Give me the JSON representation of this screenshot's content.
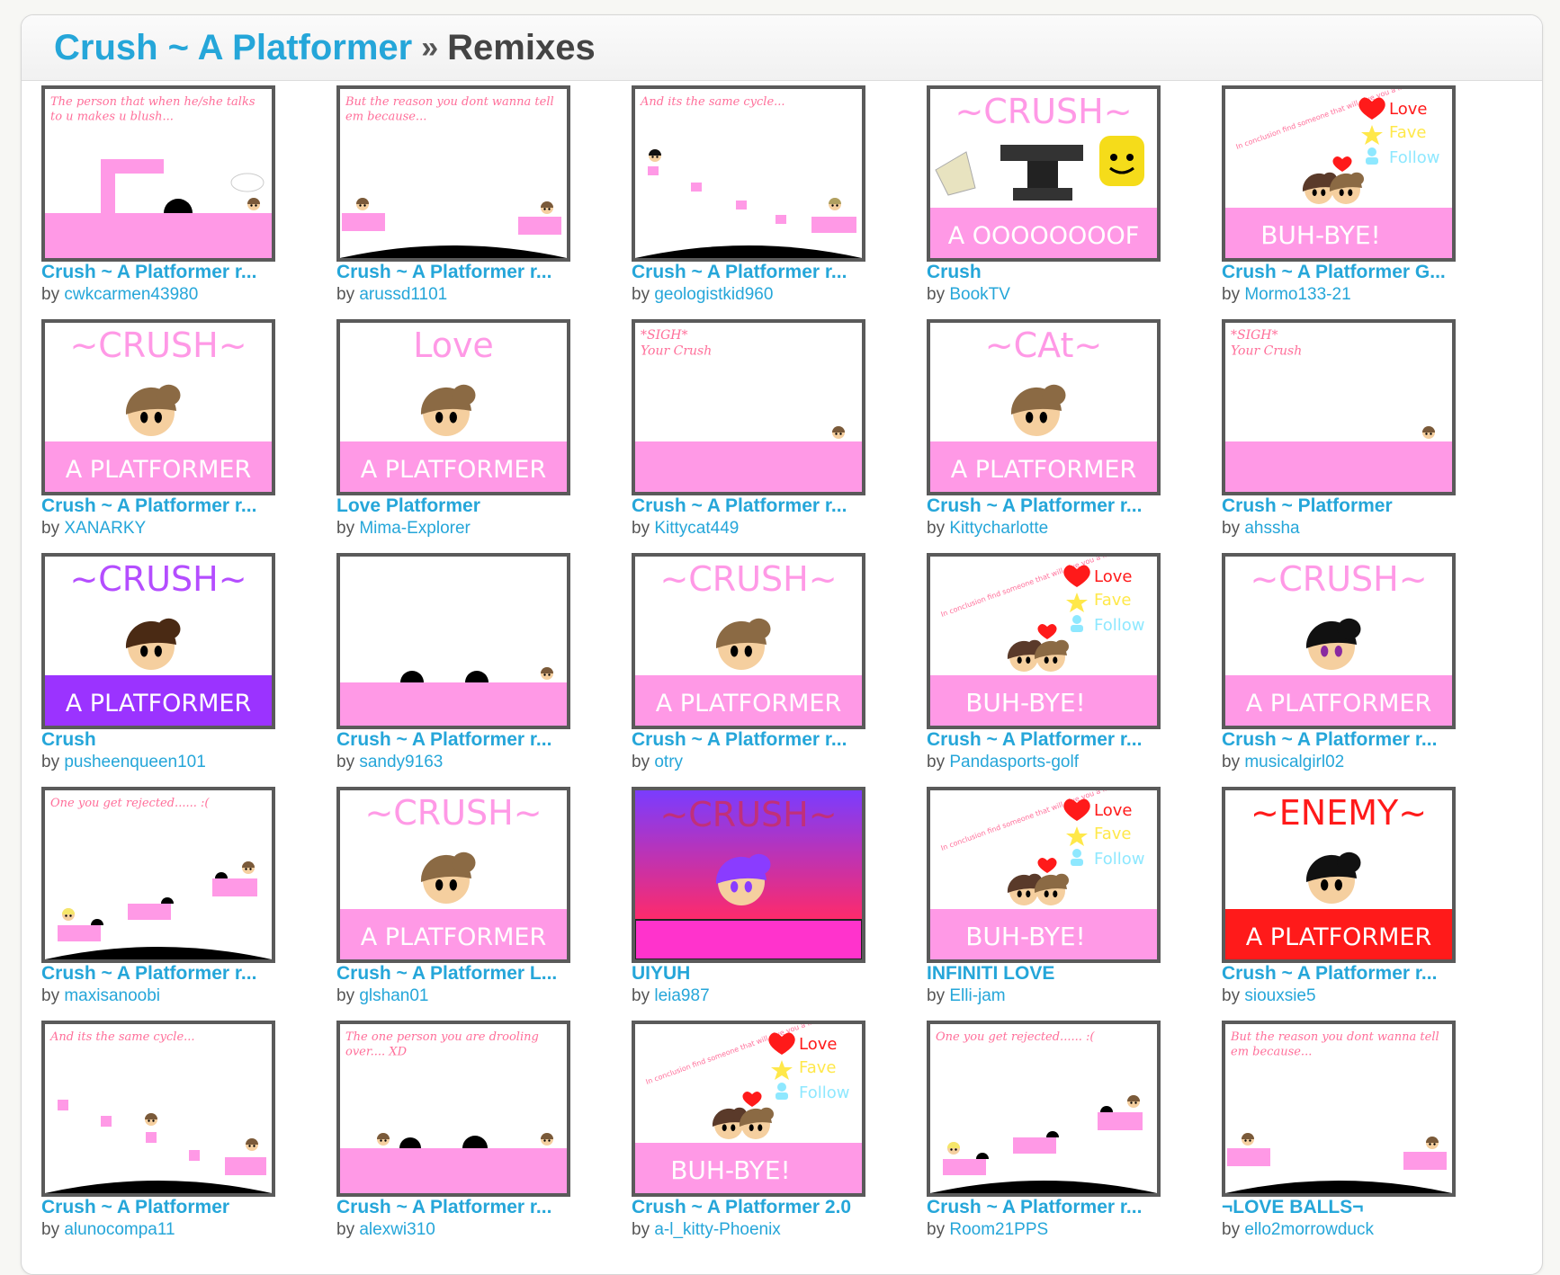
{
  "header": {
    "project_title": "Crush ~ A Platformer",
    "separator": "»",
    "page_title": "Remixes"
  },
  "by_label": "by",
  "colors": {
    "link": "#25a6d9",
    "pink": "#ff99e6",
    "frame": "#5a5a5a"
  },
  "projects": [
    {
      "title": "Crush ~ A Platformer r...",
      "author": "cwkcarmen43980",
      "thumb": {
        "kind": "level",
        "caption": "The person that when he/she talks to u makes u blush...",
        "variant": 1
      }
    },
    {
      "title": "Crush ~ A Platformer r...",
      "author": "arussd1101",
      "thumb": {
        "kind": "level",
        "caption": "But the reason you dont wanna tell em because...",
        "variant": 2
      }
    },
    {
      "title": "Crush ~ A Platformer r...",
      "author": "geologistkid960",
      "thumb": {
        "kind": "level",
        "caption": "And its the same cycle...",
        "variant": 3
      }
    },
    {
      "title": "Crush",
      "author": "BookTV",
      "thumb": {
        "kind": "banner",
        "heading": "~CRUSH~",
        "band": "A OOOOOOOOF",
        "band_color": "#ff99e6",
        "heading_color": "#ff99e6",
        "variant": "oof"
      }
    },
    {
      "title": "Crush ~ A Platformer G...",
      "author": "Mormo133-21",
      "thumb": {
        "kind": "bye",
        "band": "BUH-BYE!",
        "love": "Love",
        "fave": "Fave",
        "follow": "Follow",
        "note": "In conclusion find someone that will give you a lifetime of love!"
      }
    },
    {
      "title": "Crush ~ A Platformer r...",
      "author": "XANARKY",
      "thumb": {
        "kind": "banner",
        "heading": "~CRUSH~",
        "band": "A PLATFORMER",
        "band_color": "#ff99e6",
        "heading_color": "#ff99e6",
        "variant": "face"
      }
    },
    {
      "title": "Love Platformer",
      "author": "Mima-Explorer",
      "thumb": {
        "kind": "banner",
        "heading": "Love",
        "band": "A PLATFORMER",
        "band_color": "#ff99e6",
        "heading_color": "#ff99e6",
        "variant": "face"
      }
    },
    {
      "title": "Crush ~ A Platformer r...",
      "author": "Kittycat449",
      "thumb": {
        "kind": "sigh",
        "caption": "*SIGH* Your Crush"
      }
    },
    {
      "title": "Crush ~ A Platformer r...",
      "author": "Kittycharlotte",
      "thumb": {
        "kind": "banner",
        "heading": "~CAt~",
        "band": "A PLATFORMER",
        "band_color": "#ff99e6",
        "heading_color": "#ff99e6",
        "variant": "face"
      }
    },
    {
      "title": "Crush ~ Platformer",
      "author": "ahssha",
      "thumb": {
        "kind": "sigh",
        "caption": "*SIGH* Your Crush"
      }
    },
    {
      "title": "Crush",
      "author": "pusheenqueen101",
      "thumb": {
        "kind": "banner",
        "heading": "~CRUSH~",
        "band": "A PLATFORMER",
        "band_color": "#9b33ff",
        "heading_color": "#b44dff",
        "variant": "darkface"
      }
    },
    {
      "title": "Crush ~ A Platformer r...",
      "author": "sandy9163",
      "thumb": {
        "kind": "level",
        "caption": "",
        "variant": 4
      }
    },
    {
      "title": "Crush ~ A Platformer r...",
      "author": "otry",
      "thumb": {
        "kind": "banner",
        "heading": "~CRUSH~",
        "band": "A PLATFORMER",
        "band_color": "#ff99e6",
        "heading_color": "#ff99e6",
        "variant": "face"
      }
    },
    {
      "title": "Crush ~ A Platformer r...",
      "author": "Pandasports-golf",
      "thumb": {
        "kind": "bye",
        "band": "BUH-BYE!",
        "love": "Love",
        "fave": "Fave",
        "follow": "Follow",
        "note": "In conclusion find someone that will give you a lifetime of love!"
      }
    },
    {
      "title": "Crush ~ A Platformer r...",
      "author": "musicalgirl02",
      "thumb": {
        "kind": "banner",
        "heading": "~CRUSH~",
        "band": "A PLATFORMER",
        "band_color": "#ff99e6",
        "heading_color": "#ff99e6",
        "variant": "blackface"
      }
    },
    {
      "title": "Crush ~ A Platformer r...",
      "author": "maxisanoobi",
      "thumb": {
        "kind": "level",
        "caption": "One you get rejected...... :(",
        "variant": 5
      }
    },
    {
      "title": "Crush ~ A Platformer L...",
      "author": "glshan01",
      "thumb": {
        "kind": "banner",
        "heading": "~CRUSH~",
        "band": "A PLATFORMER",
        "band_color": "#ff99e6",
        "heading_color": "#ff99e6",
        "variant": "face"
      }
    },
    {
      "title": "UIYUH",
      "author": "leia987",
      "thumb": {
        "kind": "gradient",
        "heading": "~CRUSH~"
      }
    },
    {
      "title": "INFINITI LOVE",
      "author": "Elli-jam",
      "thumb": {
        "kind": "bye",
        "band": "BUH-BYE!",
        "love": "Love",
        "fave": "Fave",
        "follow": "Follow",
        "note": "In conclusion find someone that will give you a lifetime of love!"
      }
    },
    {
      "title": "Crush ~ A Platformer r...",
      "author": "siouxsie5",
      "thumb": {
        "kind": "banner",
        "heading": "~ENEMY~",
        "band": "A PLATFORMER",
        "band_color": "#ff1a1a",
        "heading_color": "#ff1a1a",
        "variant": "blackface"
      }
    },
    {
      "title": "Crush ~ A Platformer",
      "author": "alunocompa11",
      "thumb": {
        "kind": "level",
        "caption": "And its the same cycle...",
        "variant": 6
      }
    },
    {
      "title": "Crush ~ A Platformer r...",
      "author": "alexwi310",
      "thumb": {
        "kind": "level",
        "caption": "The one person you are drooling over.... XD",
        "variant": 7
      }
    },
    {
      "title": "Crush ~ A Platformer 2.0",
      "author": "a-l_kitty-Phoenix",
      "thumb": {
        "kind": "bye",
        "band": "BUH-BYE!",
        "love": "Love",
        "fave": "Fave",
        "follow": "Follow",
        "note": "In conclusion find someone that will give you a lifetime of love!"
      }
    },
    {
      "title": "Crush ~ A Platformer r...",
      "author": "Room21PPS",
      "thumb": {
        "kind": "level",
        "caption": "One you get rejected...... :(",
        "variant": 5
      }
    },
    {
      "title": "¬LOVE BALLS¬",
      "author": "ello2morrowduck",
      "thumb": {
        "kind": "level",
        "caption": "But the reason you dont wanna tell em because...",
        "variant": 2
      }
    }
  ]
}
